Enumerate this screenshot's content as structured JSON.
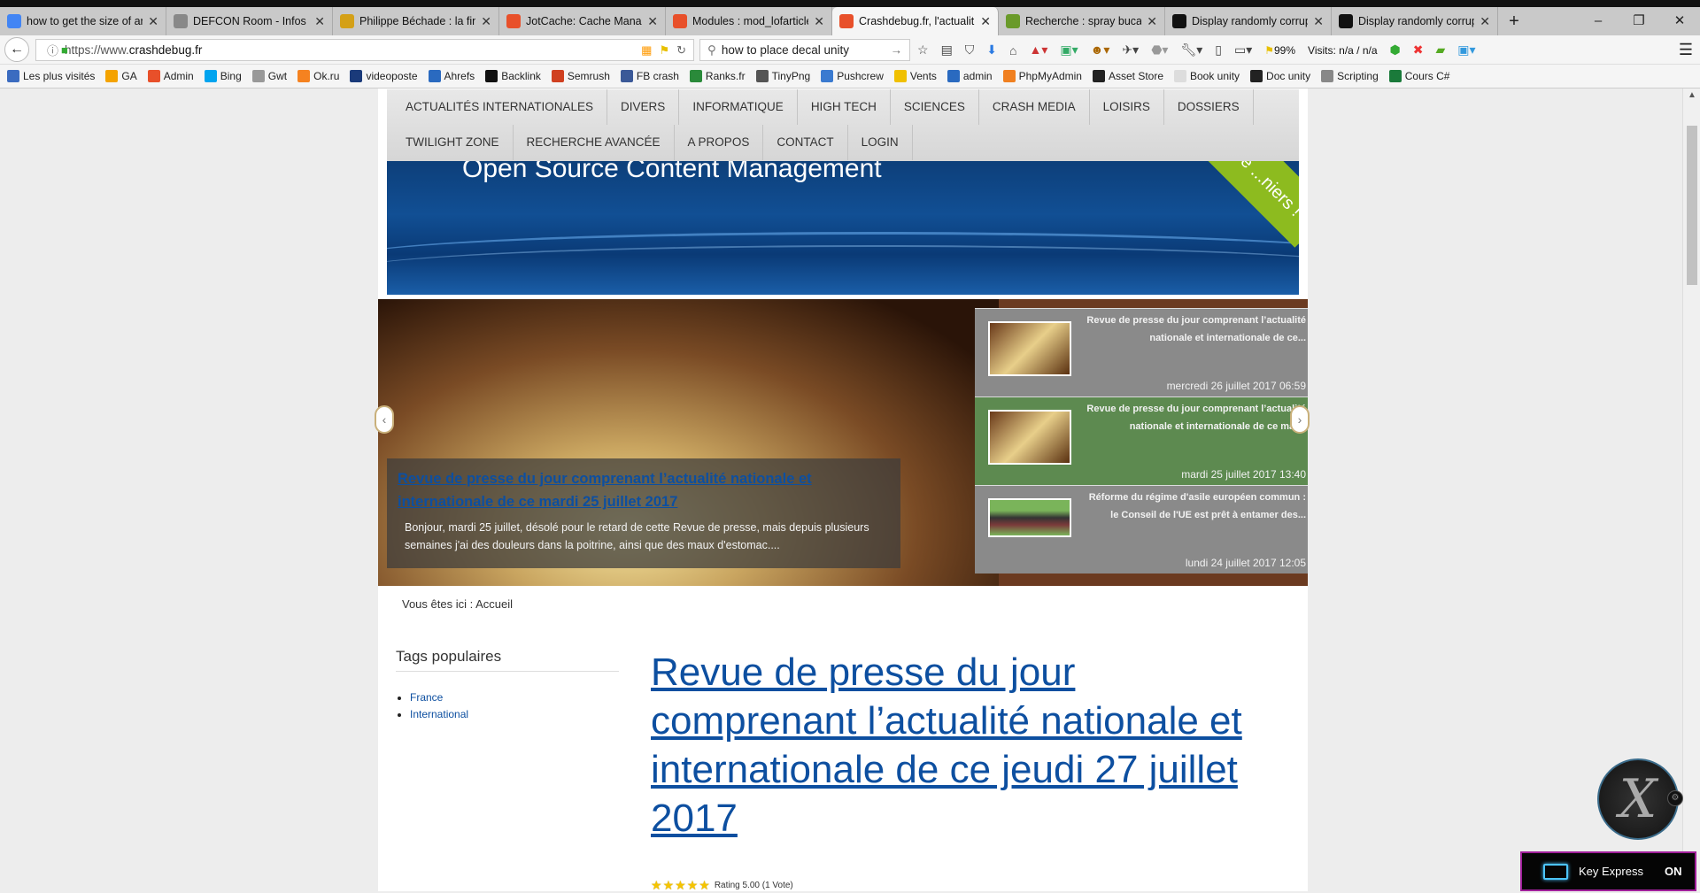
{
  "browser": {
    "tabs": [
      {
        "title": "how to get the size of an",
        "color": "#4285f4"
      },
      {
        "title": "DEFCON Room - Infos t",
        "color": "#888888"
      },
      {
        "title": "Philippe Béchade : la fina",
        "color": "#d4a017"
      },
      {
        "title": "JotCache: Cache Manag",
        "color": "#e8502a"
      },
      {
        "title": "Modules : mod_lofarticle",
        "color": "#e8502a"
      },
      {
        "title": "Crashdebug.fr, l'actualit",
        "color": "#e8502a",
        "active": true
      },
      {
        "title": "Recherche : spray bucal",
        "color": "#6a9a2a"
      },
      {
        "title": "Display randomly corrup",
        "color": "#111111"
      },
      {
        "title": "Display randomly corrup",
        "color": "#111111"
      }
    ],
    "new_tab": "+",
    "window_controls": [
      "–",
      "❐",
      "✕"
    ],
    "url_prefix": "https://www.",
    "url_domain": "crashdebug.fr",
    "search_value": "how to place decal unity",
    "zoom_text": "99%",
    "visits_text": "Visits: n/a / n/a",
    "bookmarks": [
      {
        "label": "Les plus visités",
        "color": "#3b6cc0"
      },
      {
        "label": "GA",
        "color": "#f4a300"
      },
      {
        "label": "Admin",
        "color": "#e8502a"
      },
      {
        "label": "Bing",
        "color": "#00a4ef"
      },
      {
        "label": "Gwt",
        "color": "#999999"
      },
      {
        "label": "Ok.ru",
        "color": "#f58220"
      },
      {
        "label": "videoposte",
        "color": "#1a3a7a"
      },
      {
        "label": "Ahrefs",
        "color": "#2a6ac0"
      },
      {
        "label": "Backlink",
        "color": "#111111"
      },
      {
        "label": "Semrush",
        "color": "#d04020"
      },
      {
        "label": "FB crash",
        "color": "#3b5998"
      },
      {
        "label": "Ranks.fr",
        "color": "#2a8a3a"
      },
      {
        "label": "TinyPng",
        "color": "#555555"
      },
      {
        "label": "Pushcrew",
        "color": "#3a7ad0"
      },
      {
        "label": "Vents",
        "color": "#f0c000"
      },
      {
        "label": "admin",
        "color": "#2a6ac0"
      },
      {
        "label": "PhpMyAdmin",
        "color": "#f08020"
      },
      {
        "label": "Asset Store",
        "color": "#222222"
      },
      {
        "label": "Book unity",
        "color": "#dddddd"
      },
      {
        "label": "Doc unity",
        "color": "#222222"
      },
      {
        "label": "Scripting",
        "color": "#888888"
      },
      {
        "label": "Cours C#",
        "color": "#1a7a3a"
      }
    ]
  },
  "site": {
    "menu_row1": [
      "ACTUALITÉS INTERNATIONALES",
      "DIVERS",
      "INFORMATIQUE",
      "HIGH TECH",
      "SCIENCES",
      "CRASH MEDIA",
      "LOISIRS",
      "DOSSIERS"
    ],
    "menu_row2": [
      "TWILIGHT ZONE",
      "RECHERCHE AVANCÉE",
      "A PROPOS",
      "CONTACT",
      "LOGIN"
    ],
    "banner_title": "Open Source Content Management",
    "banner_ribbon": "...re ...niers !",
    "slide": {
      "title": "Revue de presse du jour comprenant l’actualité nationale et internationale de ce mardi 25 juillet 2017",
      "excerpt": "Bonjour, mardi 25 juillet, désolé pour le retard de cette Revue de presse, mais depuis plusieurs semaines j'ai des douleurs dans la poitrine, ainsi que des maux d'estomac...."
    },
    "slide_list": [
      {
        "title": "Revue de presse du jour comprenant l’actualité nationale et internationale de ce...",
        "date": "mercredi 26 juillet 2017 06:59"
      },
      {
        "title": "Revue de presse du jour comprenant l’actualité nationale et internationale de ce mar...",
        "date": "mardi 25 juillet 2017 13:40",
        "active": true
      },
      {
        "title": "Réforme du régime d'asile européen commun : le Conseil de l'UE est prêt à entamer des...",
        "date": "lundi 24 juillet 2017 12:05"
      }
    ],
    "breadcrumb": "Vous êtes ici : Accueil",
    "tags_heading": "Tags populaires",
    "tags": [
      "France",
      "International"
    ],
    "article_title": "Revue de presse du jour comprenant l’actualité nationale et internationale de ce jeudi 27 juillet 2017",
    "rating_value": 5,
    "rating_text": "Rating 5.00 (1 Vote)"
  },
  "overlay": {
    "key_express_label": "Key Express",
    "key_express_state": "ON"
  }
}
